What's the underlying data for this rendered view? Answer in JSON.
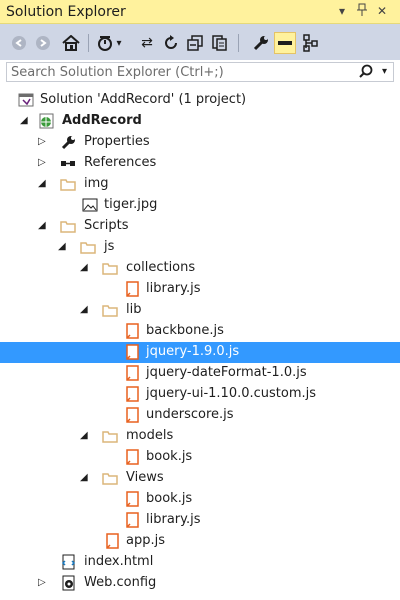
{
  "panel": {
    "title": "Solution Explorer"
  },
  "search": {
    "placeholder": "Search Solution Explorer (Ctrl+;)"
  },
  "tree": {
    "solution": "Solution 'AddRecord' (1 project)",
    "project": "AddRecord",
    "properties": "Properties",
    "references": "References",
    "img": "img",
    "tiger": "tiger.jpg",
    "scripts": "Scripts",
    "js": "js",
    "collections": "collections",
    "library_js_1": "library.js",
    "lib": "lib",
    "backbone": "backbone.js",
    "jquery": "jquery-1.9.0.js",
    "dateformat": "jquery-dateFormat-1.0.js",
    "jqueryui": "jquery-ui-1.10.0.custom.js",
    "underscore": "underscore.js",
    "models": "models",
    "book_js_1": "book.js",
    "views": "Views",
    "book_js_2": "book.js",
    "library_js_2": "library.js",
    "app": "app.js",
    "index": "index.html",
    "webconfig": "Web.config"
  },
  "colors": {
    "title_bg": "#fff29d",
    "toolbar_bg": "#cfd6e5",
    "selection": "#3399ff",
    "folder": "#dcb67a",
    "js_file": "#e8611f"
  }
}
